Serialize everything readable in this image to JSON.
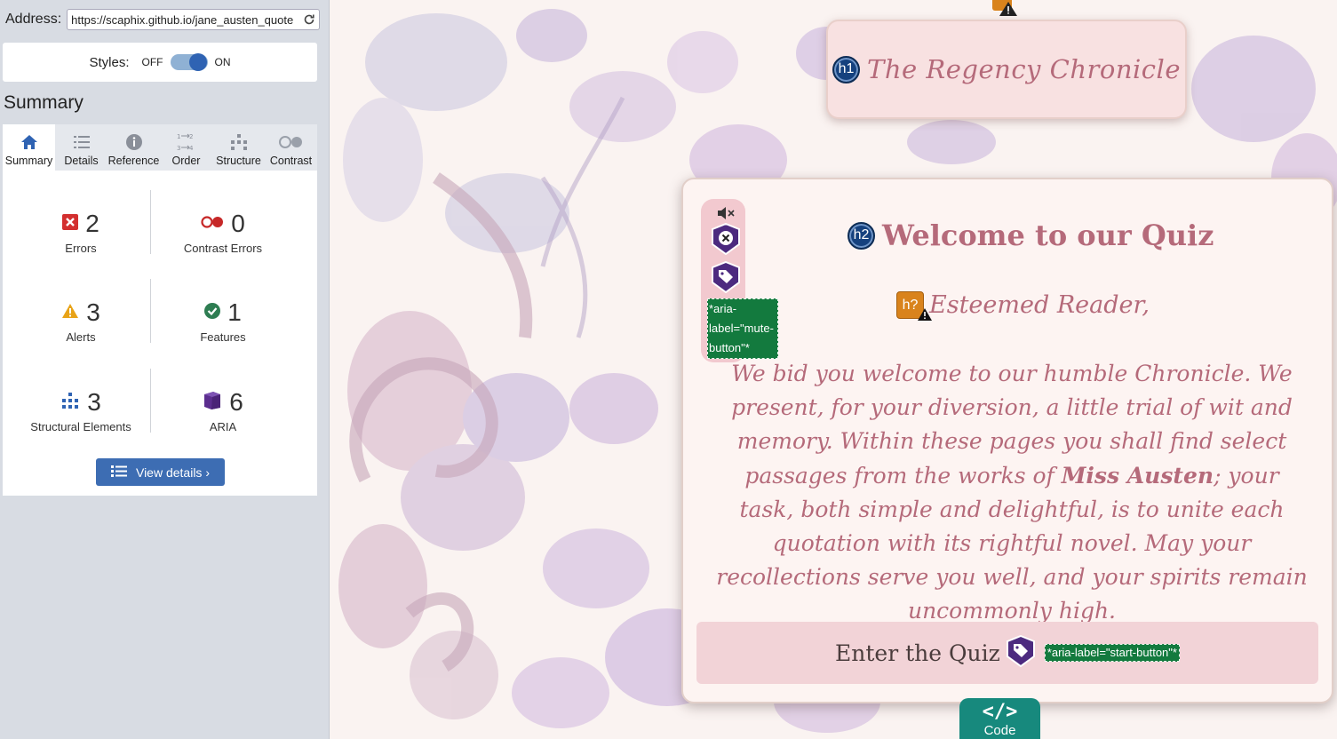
{
  "address": {
    "label": "Address:",
    "url": "https://scaphix.github.io/jane_austen_quote"
  },
  "styles": {
    "label": "Styles:",
    "off": "OFF",
    "on": "ON"
  },
  "summary": {
    "title": "Summary",
    "tabs": [
      {
        "label": "Summary",
        "icon": "home-icon",
        "active": true
      },
      {
        "label": "Details",
        "icon": "list-icon"
      },
      {
        "label": "Reference",
        "icon": "info-icon"
      },
      {
        "label": "Order",
        "icon": "order-icon"
      },
      {
        "label": "Structure",
        "icon": "structure-icon"
      },
      {
        "label": "Contrast",
        "icon": "contrast-icon"
      }
    ],
    "stats": {
      "errors": {
        "count": "2",
        "label": "Errors"
      },
      "contrast_errors": {
        "count": "0",
        "label": "Contrast Errors"
      },
      "alerts": {
        "count": "3",
        "label": "Alerts"
      },
      "features": {
        "count": "1",
        "label": "Features"
      },
      "structural": {
        "count": "3",
        "label": "Structural Elements"
      },
      "aria": {
        "count": "6",
        "label": "ARIA"
      }
    },
    "view_details": "View details ›"
  },
  "page": {
    "site_title": "The Regency Chronicle",
    "h1_badge": "h1",
    "h2_badge": "h2",
    "hq_badge": "h?",
    "welcome": "Welcome to our Quiz",
    "greeting": "Esteemed Reader,",
    "intro_before": "We bid you welcome to our humble Chronicle. We present, for your diversion, a little trial of wit and memory. Within these pages you shall find select passages from the works of ",
    "intro_bold": "Miss Austen",
    "intro_after": "; your task, both simple and delightful, is to unite each quotation with its rightful novel. May your recollections serve you well, and your spirits remain uncommonly high.",
    "mute_aria": "*aria-label=\"mute-button\"*",
    "start_label": "Enter the Quiz",
    "start_aria": "*aria-label=\"start-button\"*",
    "code_label": "Code",
    "code_glyph": "</>"
  },
  "colors": {
    "accent": "#b56a7a",
    "wave_blue": "#15417e",
    "code_teal": "#17897d",
    "aria_green": "#137a3e"
  }
}
